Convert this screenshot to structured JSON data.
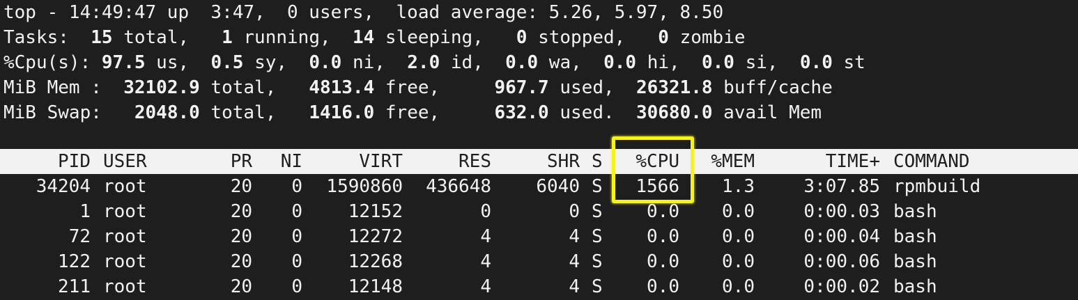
{
  "summary": {
    "line1": "top - 14:49:47 up  3:47,  0 users,  load average: 5.26, 5.97, 8.50",
    "tasks": {
      "label": "Tasks: ",
      "total": " 15",
      "total_lbl": " total, ",
      "running": "  1",
      "running_lbl": " running, ",
      "sleeping": " 14",
      "sleeping_lbl": " sleeping, ",
      "stopped": "  0",
      "stopped_lbl": " stopped, ",
      "zombie": "  0",
      "zombie_lbl": " zombie"
    },
    "cpu": {
      "label": "%Cpu(s): ",
      "us": "97.5",
      "us_lbl": " us, ",
      "sy": " 0.5",
      "sy_lbl": " sy, ",
      "ni": " 0.0",
      "ni_lbl": " ni, ",
      "id": " 2.0",
      "id_lbl": " id, ",
      "wa": " 0.0",
      "wa_lbl": " wa, ",
      "hi": " 0.0",
      "hi_lbl": " hi, ",
      "si": " 0.0",
      "si_lbl": " si, ",
      "st": " 0.0",
      "st_lbl": " st"
    },
    "mem": {
      "label": "MiB Mem : ",
      "total": " 32102.9",
      "total_lbl": " total, ",
      "free": "  4813.4",
      "free_lbl": " free, ",
      "used": "    967.7",
      "used_lbl": " used, ",
      "buff": " 26321.8",
      "buff_lbl": " buff/cache"
    },
    "swap": {
      "label": "MiB Swap: ",
      "total": "  2048.0",
      "total_lbl": " total, ",
      "free": "  1416.0",
      "free_lbl": " free, ",
      "used": "    632.0",
      "used_lbl": " used. ",
      "avail": " 30680.0",
      "avail_lbl": " avail Mem"
    }
  },
  "table": {
    "headers": [
      "PID",
      "USER",
      "PR",
      "NI",
      "VIRT",
      "RES",
      "SHR",
      "S",
      "%CPU",
      "%MEM",
      "TIME+",
      "COMMAND"
    ],
    "rows": [
      [
        "34204",
        "root",
        "20",
        "0",
        "1590860",
        "436648",
        "6040",
        "S",
        "1566",
        "1.3",
        "3:07.85",
        "rpmbuild"
      ],
      [
        "1",
        "root",
        "20",
        "0",
        "12152",
        "0",
        "0",
        "S",
        "0.0",
        "0.0",
        "0:00.03",
        "bash"
      ],
      [
        "72",
        "root",
        "20",
        "0",
        "12272",
        "4",
        "4",
        "S",
        "0.0",
        "0.0",
        "0:00.04",
        "bash"
      ],
      [
        "122",
        "root",
        "20",
        "0",
        "12268",
        "4",
        "4",
        "S",
        "0.0",
        "0.0",
        "0:00.06",
        "bash"
      ],
      [
        "211",
        "root",
        "20",
        "0",
        "12148",
        "4",
        "4",
        "S",
        "0.0",
        "0.0",
        "0:00.02",
        "bash"
      ]
    ]
  },
  "highlight": {
    "color": "#f5f222",
    "target": "%CPU"
  }
}
